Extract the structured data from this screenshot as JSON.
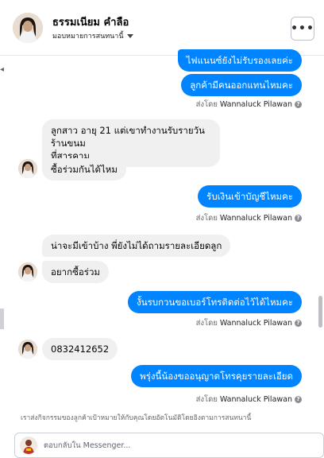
{
  "header": {
    "contact_name": "ธรรมเนียม คำลือ",
    "assign_label": "มอบหมายการสนทนานี้",
    "more_label": "•••"
  },
  "messages": [
    {
      "type": "outgoing",
      "text": "ไฟแนนซ์ยังไม่รับรองเลยค่ะ"
    },
    {
      "type": "outgoing",
      "text": "ลูกค้ามีคนออกแทนไหมคะ"
    },
    {
      "type": "sent_by",
      "prefix": "ส่งโดย",
      "name": "Wannaluck Pilawan"
    },
    {
      "type": "incoming",
      "text_line1": "ลูกสาว อายุ 21 แต่เขาทำงานรับรายวัน  ร้านขนม",
      "text_line2": "ที่สารคาม"
    },
    {
      "type": "incoming",
      "text": "ซื้อร่วมกันได้ไหม"
    },
    {
      "type": "outgoing",
      "text": "รับเงินเข้าบัญชีไหมคะ"
    },
    {
      "type": "sent_by",
      "prefix": "ส่งโดย",
      "name": "Wannaluck Pilawan"
    },
    {
      "type": "incoming",
      "text": "น่าจะมีเข้าบ้าง พี่ยังไม่ได้ถามรายละเอียดลูก"
    },
    {
      "type": "incoming",
      "text": "อยากซื้อร่วม"
    },
    {
      "type": "outgoing",
      "text": "งั้นรบกวนขอเบอร์โทรติดต่อไว้ได้ไหมคะ"
    },
    {
      "type": "sent_by",
      "prefix": "ส่งโดย",
      "name": "Wannaluck Pilawan"
    },
    {
      "type": "incoming",
      "text": "0832412652"
    },
    {
      "type": "outgoing",
      "text": "พรุ่งนี้น้องขออนุญาตโทรคุยรายละเอียด"
    },
    {
      "type": "sent_by",
      "prefix": "ส่งโดย",
      "name": "Wannaluck Pilawan"
    }
  ],
  "footer_note": "เราส่งกิจกรรมของลูกค้าเป้าหมายให้กับคุณโดยอัตโนมัติโดยอิงตามการสนทนานี้",
  "composer": {
    "placeholder": "ตอบกลับใน Messenger..."
  },
  "colors": {
    "outgoing_bubble": "#0084ff",
    "incoming_bubble": "#f0f0f0"
  },
  "icons": [
    "chevron-down-icon",
    "more-dots-icon",
    "info-icon",
    "left-arrow-icon"
  ]
}
